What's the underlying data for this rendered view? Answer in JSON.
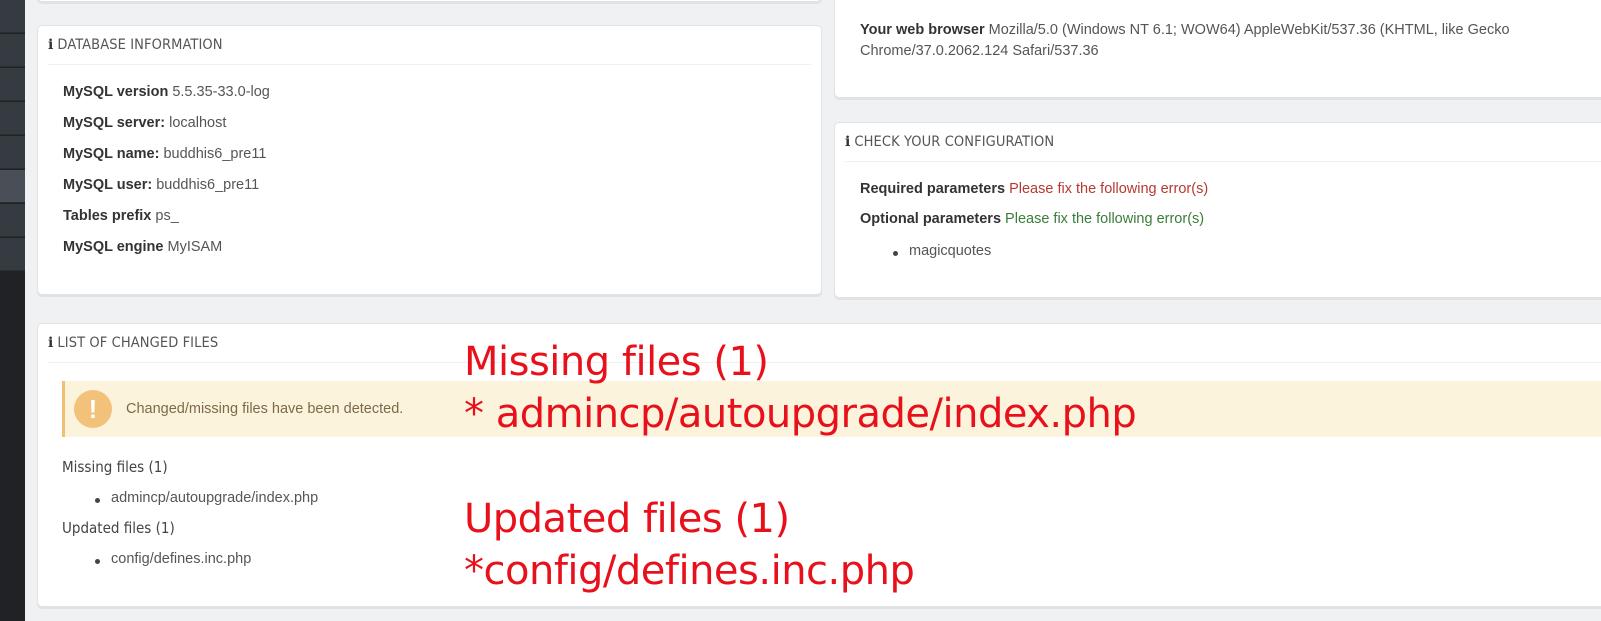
{
  "browser_panel": {
    "label": "Your web browser",
    "line1": "Mozilla/5.0 (Windows NT 6.1; WOW64) AppleWebKit/537.36 (KHTML, like Gecko",
    "line2": "Chrome/37.0.2062.124 Safari/537.36"
  },
  "database_panel": {
    "title": "DATABASE INFORMATION",
    "rows": [
      {
        "label": "MySQL version",
        "value": "5.5.35-33.0-log"
      },
      {
        "label": "MySQL server:",
        "value": "localhost"
      },
      {
        "label": "MySQL name:",
        "value": "buddhis6_pre11"
      },
      {
        "label": "MySQL user:",
        "value": "buddhis6_pre11"
      },
      {
        "label": "Tables prefix",
        "value": "ps_"
      },
      {
        "label": "MySQL engine",
        "value": "MyISAM"
      }
    ]
  },
  "config_panel": {
    "title": "CHECK YOUR CONFIGURATION",
    "required_label": "Required parameters",
    "required_status": "Please fix the following error(s)",
    "optional_label": "Optional parameters",
    "optional_status": "Please fix the following error(s)",
    "optional_items": [
      "magicquotes"
    ]
  },
  "changed_files_panel": {
    "title": "LIST OF CHANGED FILES",
    "warning_icon": "!",
    "warning_text": "Changed/missing files have been detected.",
    "missing_heading": "Missing files (1)",
    "missing_items": [
      "admincp/autoupgrade/index.php"
    ],
    "updated_heading": "Updated files (1)",
    "updated_items": [
      "config/defines.inc.php"
    ]
  },
  "annotations": {
    "missing_title": "Missing files (1)",
    "missing_item": "* admincp/autoupgrade/index.php",
    "updated_title": "Updated files (1)",
    "updated_item": "*config/defines.inc.php",
    "color": "#e8111b"
  },
  "icons": {
    "info": "info-icon",
    "warning": "warning-icon"
  }
}
